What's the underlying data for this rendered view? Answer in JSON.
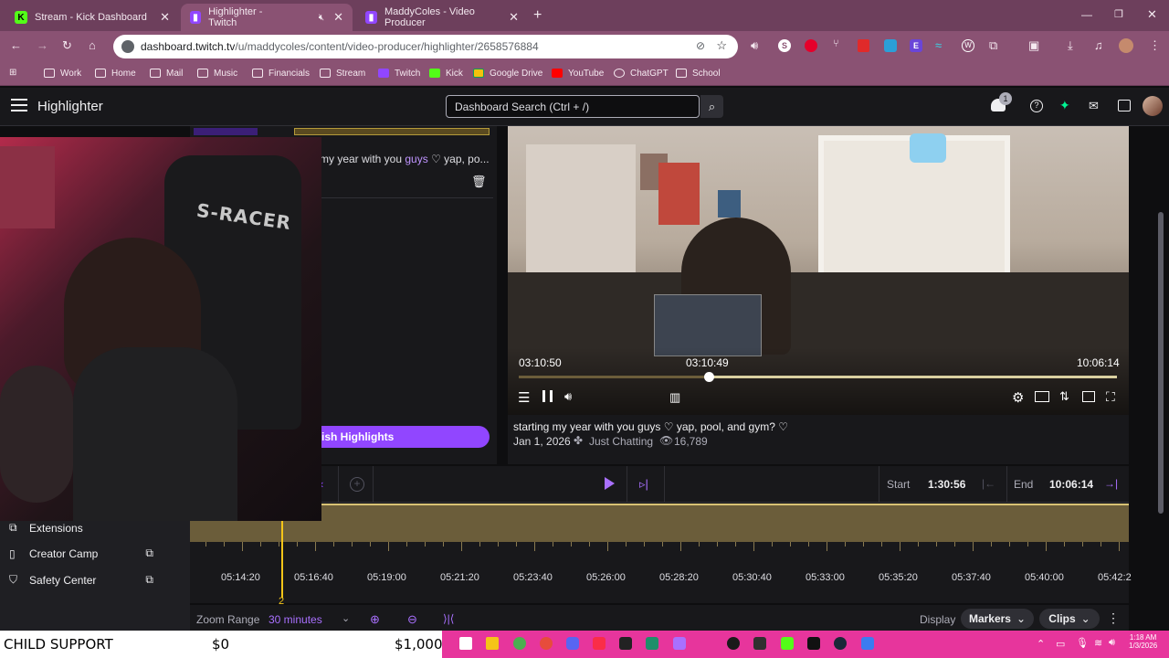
{
  "browser": {
    "tabs": [
      {
        "label": "Stream - Kick Dashboard",
        "favicon": "K",
        "color": "#53fc18",
        "active": false
      },
      {
        "label": "Highlighter - Twitch",
        "favicon": "twitch-icon",
        "color": "#9146ff",
        "active": true
      },
      {
        "label": "MaddyColes - Video Producer",
        "favicon": "twitch-icon",
        "color": "#9146ff",
        "active": false
      }
    ],
    "url_host": "dashboard.twitch.tv",
    "url_path": "/u/maddycoles/content/video-producer/highlighter/2658576884",
    "bookmarks": [
      "Work",
      "Home",
      "Mail",
      "Music",
      "Financials",
      "Stream",
      "Twitch",
      "Kick",
      "Google Drive",
      "YouTube",
      "ChatGPT",
      "School"
    ]
  },
  "header": {
    "title": "Highlighter",
    "search_placeholder": "Dashboard Search (Ctrl + /)",
    "notification_count": "1"
  },
  "left_panel": {
    "title_snippet": "my year with you ",
    "title_link": "guys",
    "title_rest": " ♡ yap, po...",
    "publish_label": "ish Highlights"
  },
  "player": {
    "start_time": "03:10:50",
    "hover_time": "03:10:49",
    "end_time": "10:06:14",
    "progress": 0.318
  },
  "video_info": {
    "title": "starting my year with you guys ♡ yap, pool, and gym? ♡",
    "date": "Jan 1, 2026",
    "category": "Just Chatting",
    "views": "16,789"
  },
  "timeline": {
    "start_label": "Start",
    "start_value": "1:30:56",
    "end_label": "End",
    "end_value": "10:06:14",
    "ticks": [
      "05:14:20",
      "05:16:40",
      "05:19:00",
      "05:21:20",
      "05:23:40",
      "05:26:00",
      "05:28:20",
      "05:30:40",
      "05:33:00",
      "05:35:20",
      "05:37:40",
      "05:40:00",
      "05:42:2"
    ],
    "marker_label": "2"
  },
  "zoom": {
    "label": "Zoom Range",
    "value": "30 minutes",
    "display_label": "Display",
    "markers_label": "Markers",
    "clips_label": "Clips"
  },
  "sidebar": {
    "items": [
      "Extensions",
      "Creator Camp",
      "Safety Center"
    ]
  },
  "ticker": {
    "label": "CHILD SUPPORT",
    "value1": "$0",
    "value2": "$1,000"
  },
  "clock": {
    "time": "1:18 AM",
    "date": "1/3/2026"
  },
  "colors": {
    "accent": "#9146ff",
    "chrome": "#8a5273",
    "taskbar": "#e7359c",
    "timeline_band": "#6b5d3a"
  }
}
